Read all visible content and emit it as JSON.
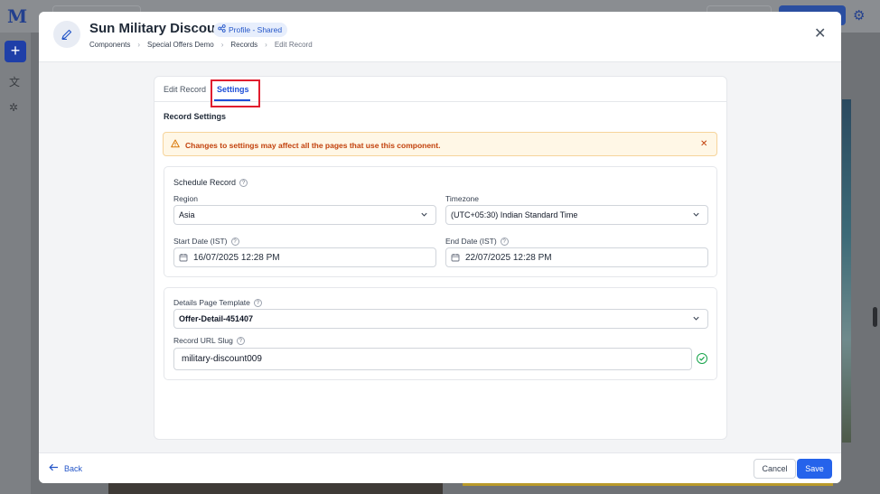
{
  "background": {
    "logo": "M",
    "accent_color": "#23408e"
  },
  "header": {
    "title": "Sun Military Discount",
    "badge": "Profile - Shared",
    "breadcrumb": [
      "Components",
      "Special Offers Demo",
      "Records",
      "Edit Record"
    ]
  },
  "tabs": [
    {
      "label": "Edit Record",
      "active": false
    },
    {
      "label": "Settings",
      "active": true
    }
  ],
  "section_title": "Record Settings",
  "alert": {
    "text": "Changes to settings may affect all the pages that use this component.",
    "color": "#c2410c"
  },
  "schedule": {
    "title": "Schedule Record",
    "region_label": "Region",
    "region_value": "Asia",
    "timezone_label": "Timezone",
    "timezone_value": "(UTC+05:30) Indian Standard Time",
    "start_label": "Start Date (IST)",
    "start_value": "16/07/2025 12:28 PM",
    "end_label": "End Date (IST)",
    "end_value": "22/07/2025 12:28 PM"
  },
  "details": {
    "template_label": "Details Page Template",
    "template_value": "Offer-Detail-451407",
    "slug_label": "Record URL Slug",
    "slug_value": "military-discount009"
  },
  "footer": {
    "back_label": "Back",
    "cancel_label": "Cancel",
    "save_label": "Save",
    "primary_color": "#2563eb"
  }
}
